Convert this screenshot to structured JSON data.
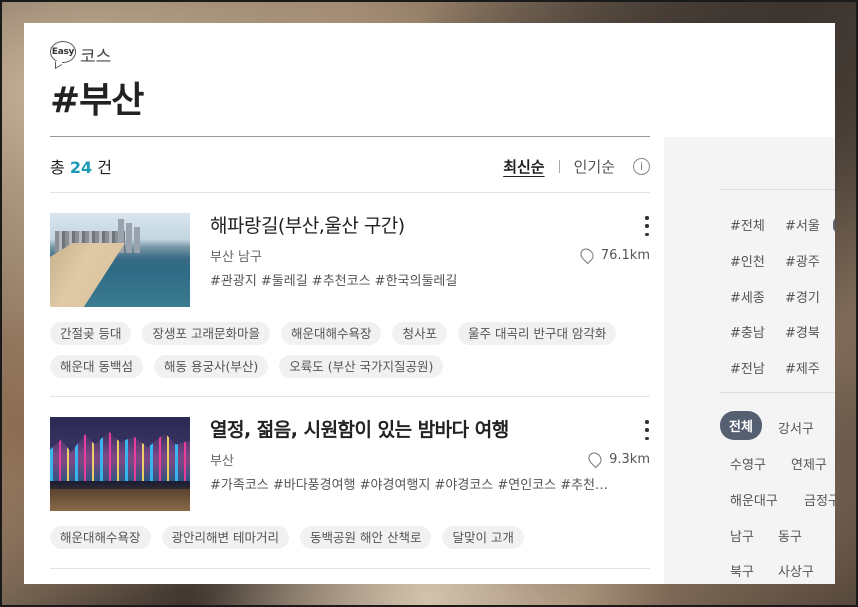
{
  "header": {
    "badge": "Easy",
    "course_label": "코스",
    "title": "#부산"
  },
  "summary": {
    "prefix": "총",
    "count": "24",
    "suffix": "건",
    "sort_latest": "최신순",
    "sort_popular": "인기순",
    "info_glyph": "i"
  },
  "items": [
    {
      "title": "해파랑길(부산,울산 구간)",
      "location": "부산 남구",
      "distance": "76.1km",
      "tags": "#관광지 #둘레길 #추천코스 #한국의둘레길",
      "spots": [
        "간절곶 등대",
        "장생포 고래문화마을",
        "해운대해수욕장",
        "청사포",
        "울주 대곡리 반구대 암각화",
        "해운대 동백섬",
        "해동 용궁사(부산)",
        "오륙도 (부산 국가지질공원)"
      ]
    },
    {
      "title": "열정, 젊음, 시원함이 있는 밤바다 여행",
      "location": "부산",
      "distance": "9.3km",
      "tags": "#가족코스 #바다풍경여행 #야경여행지 #야경코스 #연인코스 #추천…",
      "spots": [
        "해운대해수욕장",
        "광안리해변 테마거리",
        "동백공원 해안 산책로",
        "달맞이 고개"
      ]
    }
  ],
  "sidebar": {
    "regions": [
      "#전체",
      "#서울",
      "#인천",
      "#광주",
      "#세종",
      "#경기",
      "#충남",
      "#경북",
      "#전남",
      "#제주"
    ],
    "districts": [
      "전체",
      "강서구",
      "수영구",
      "연제구",
      "해운대구",
      "금정구",
      "남구",
      "동구",
      "북구",
      "사상구"
    ]
  },
  "colors": {
    "accent_count": "#1a9ab5",
    "active_district_bg": "#555f72"
  }
}
